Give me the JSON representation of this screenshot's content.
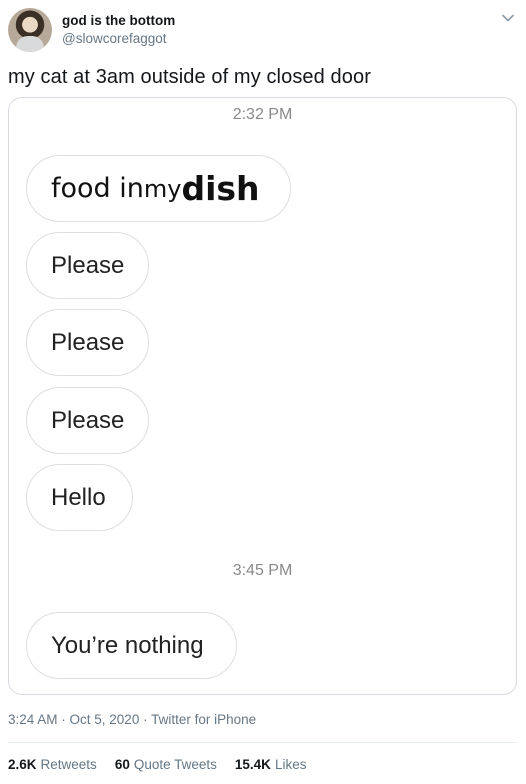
{
  "author": {
    "display_name": "god is the bottom",
    "handle": "@slowcorefaggot"
  },
  "tweet": {
    "text": "my cat at 3am outside of my closed door"
  },
  "screenshot": {
    "timestamp_1": "2:32 PM",
    "first_message": {
      "part_1": "food in ",
      "part_2": "my ",
      "part_3": "dish"
    },
    "messages": [
      "Please",
      "Please",
      "Please",
      "Hello"
    ],
    "timestamp_2": "3:45 PM",
    "last_message": "You’re nothing"
  },
  "meta": {
    "posted": "3:24 AM · Oct 5, 2020 · Twitter for iPhone"
  },
  "stats": {
    "retweets_count": "2.6K",
    "retweets_label": "Retweets",
    "quotes_count": "60",
    "quotes_label": "Quote Tweets",
    "likes_count": "15.4K",
    "likes_label": "Likes"
  },
  "icons": {
    "menu": "chevron-down-icon"
  }
}
